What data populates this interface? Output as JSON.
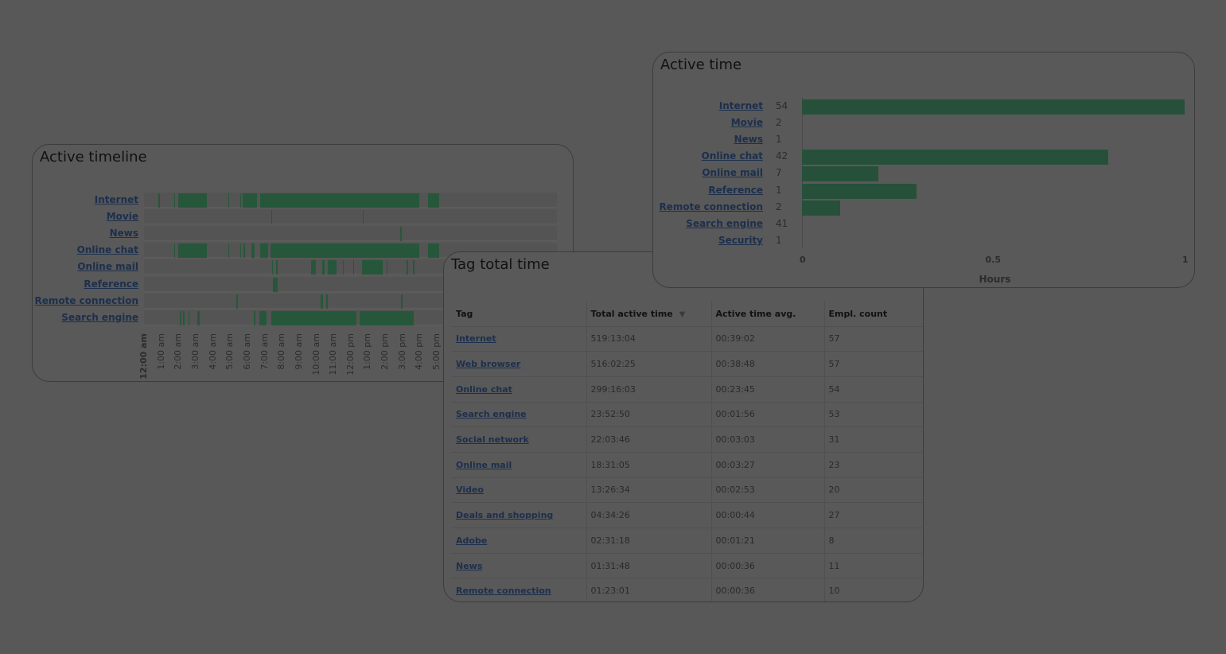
{
  "active_timeline": {
    "title": "Active timeline",
    "tags": [
      "Internet",
      "Movie",
      "News",
      "Online chat",
      "Online mail",
      "Reference",
      "Remote connection",
      "Search engine"
    ],
    "hour_labels": [
      "12:00 am",
      "1:00 am",
      "2:00 am",
      "3:00 am",
      "4:00 am",
      "5:00 am",
      "6:00 am",
      "7:00 am",
      "8:00 am",
      "9:00 am",
      "10:00 am",
      "11:00 am",
      "12:00 pm",
      "1:00 pm",
      "2:00 pm",
      "3:00 pm",
      "4:00 pm",
      "5:00 pm"
    ],
    "segments_hours": [
      [
        [
          0.85,
          0.9
        ],
        [
          1.74,
          1.8
        ],
        [
          2.0,
          3.67
        ],
        [
          4.88,
          4.93
        ],
        [
          5.58,
          5.63
        ],
        [
          5.75,
          6.55
        ],
        [
          6.75,
          15.97
        ],
        [
          16.5,
          17.15
        ]
      ],
      [
        [
          7.38,
          7.43
        ],
        [
          12.68,
          12.73
        ]
      ],
      [
        [
          14.88,
          14.93
        ]
      ],
      [
        [
          1.74,
          1.8
        ],
        [
          2.0,
          3.67
        ],
        [
          4.88,
          4.93
        ],
        [
          5.58,
          5.63
        ],
        [
          5.78,
          5.83
        ],
        [
          6.25,
          6.4
        ],
        [
          6.75,
          7.2
        ],
        [
          7.35,
          15.97
        ],
        [
          16.5,
          17.15
        ]
      ],
      [
        [
          7.43,
          7.48
        ],
        [
          7.68,
          7.73
        ],
        [
          9.7,
          10.0
        ],
        [
          10.35,
          10.5
        ],
        [
          10.65,
          11.2
        ],
        [
          11.53,
          11.58
        ],
        [
          12.13,
          12.18
        ],
        [
          12.65,
          13.85
        ],
        [
          14.08,
          14.13
        ],
        [
          15.25,
          15.35
        ],
        [
          15.63,
          15.68
        ]
      ],
      [
        [
          7.5,
          7.75
        ]
      ],
      [
        [
          5.38,
          5.43
        ],
        [
          10.25,
          10.4
        ],
        [
          10.58,
          10.63
        ],
        [
          14.93,
          14.98
        ]
      ],
      [
        [
          2.08,
          2.13
        ],
        [
          2.28,
          2.33
        ],
        [
          2.58,
          2.63
        ],
        [
          3.1,
          3.25
        ],
        [
          6.38,
          6.43
        ],
        [
          6.7,
          7.1
        ],
        [
          7.4,
          12.35
        ],
        [
          12.5,
          15.65
        ]
      ]
    ],
    "bar_color": "#27573a"
  },
  "tag_total_time": {
    "title": "Tag total time",
    "columns": [
      "Tag",
      "Total active time",
      "Active time avg.",
      "Empl. count"
    ],
    "sort_icon": "sort-desc-triangle",
    "rows": [
      [
        "Internet",
        "519:13:04",
        "00:39:02",
        "57"
      ],
      [
        "Web browser",
        "516:02:25",
        "00:38:48",
        "57"
      ],
      [
        "Online chat",
        "299:16:03",
        "00:23:45",
        "54"
      ],
      [
        "Search engine",
        "23:52:50",
        "00:01:56",
        "53"
      ],
      [
        "Social network",
        "22:03:46",
        "00:03:03",
        "31"
      ],
      [
        "Online mail",
        "18:31:05",
        "00:03:27",
        "23"
      ],
      [
        "Video",
        "13:26:34",
        "00:02:53",
        "20"
      ],
      [
        "Deals and shopping",
        "04:34:26",
        "00:00:44",
        "27"
      ],
      [
        "Adobe",
        "02:31:18",
        "00:01:21",
        "8"
      ],
      [
        "News",
        "01:31:48",
        "00:00:36",
        "11"
      ],
      [
        "Remote connection",
        "01:23:01",
        "00:00:36",
        "10"
      ]
    ]
  },
  "active_time": {
    "title": "Active time",
    "tags": [
      "Internet",
      "Movie",
      "News",
      "Online chat",
      "Online mail",
      "Reference",
      "Remote connection",
      "Search engine",
      "Security"
    ],
    "counts": [
      "54",
      "2",
      "1",
      "42",
      "7",
      "1",
      "2",
      "41",
      "1"
    ],
    "hours": [
      1.0,
      0,
      0,
      0.8,
      0.2,
      0.3,
      0.1,
      0,
      0
    ],
    "axis_ticks": [
      "0",
      "0.5",
      "1"
    ],
    "xlabel": "Hours",
    "xlim": [
      0,
      1
    ],
    "bar_color": "#27503a"
  }
}
